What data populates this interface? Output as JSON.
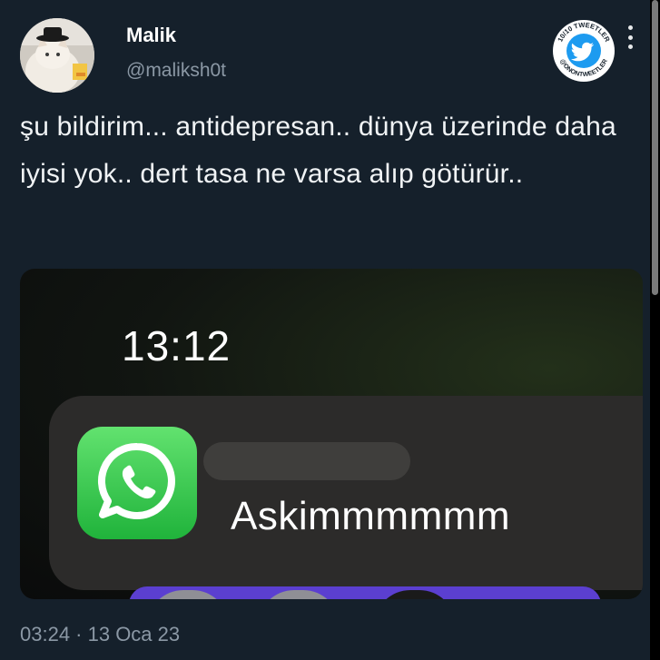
{
  "author": {
    "name": "Malik",
    "handle": "@maliksh0t"
  },
  "watermark": {
    "line1": "10/10 TWEETLER",
    "line2": "@ONONTWEETLER",
    "icon": "twitter-bird-icon"
  },
  "tweet": {
    "text": "şu bildirim... antidepresan.. dünya üzerinde daha iyisi yok.. dert tasa ne varsa alıp götürür..",
    "timestamp": "03:24 · 13 Oca 23"
  },
  "media": {
    "lock_time": "13:12",
    "notification": {
      "app_icon": "whatsapp-icon",
      "message": "Askimmmmmm"
    }
  },
  "colors": {
    "background": "#15202b",
    "secondary_text": "#8b98a5",
    "whatsapp_green": "#25d366",
    "watermark_blue": "#1d9bf0"
  }
}
